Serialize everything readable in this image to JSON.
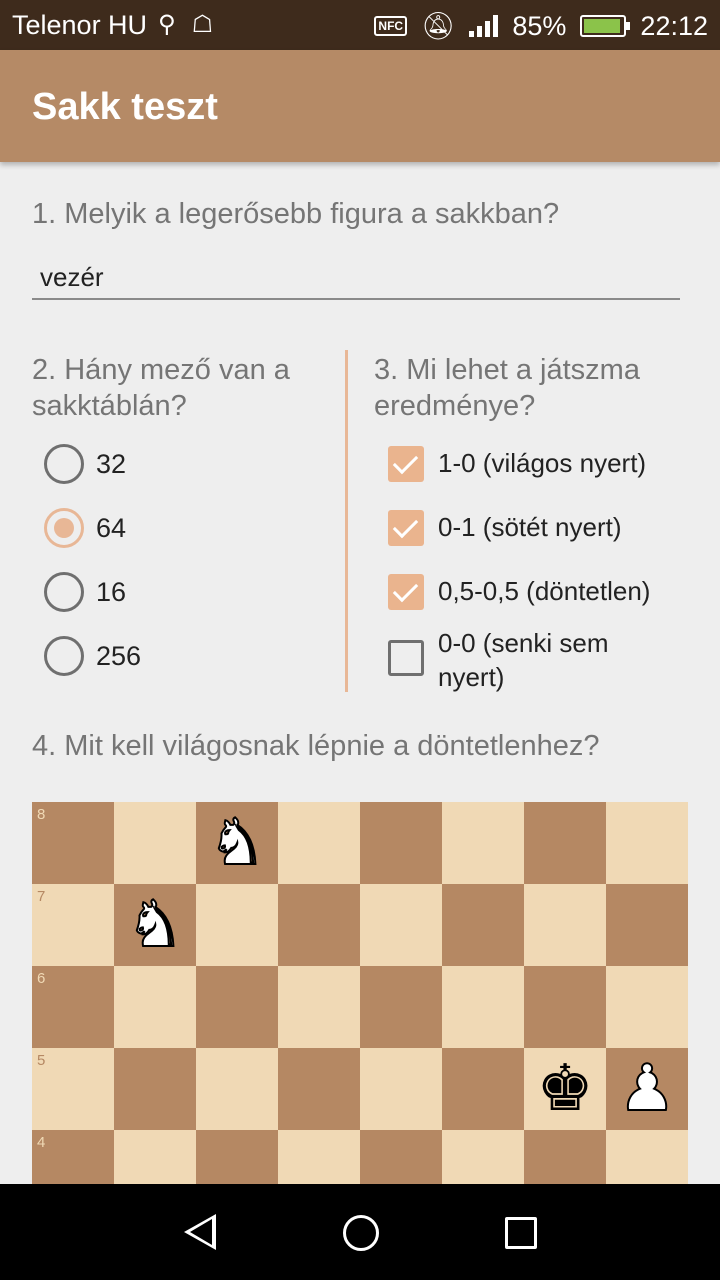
{
  "status": {
    "carrier": "Telenor HU",
    "usb_icon": "usb-icon",
    "android_icon": "android-debug-icon",
    "nfc": "NFC",
    "battery_percent": "85%",
    "battery_level": 0.85,
    "time": "22:12"
  },
  "appbar": {
    "title": "Sakk teszt"
  },
  "q1": {
    "question": "1. Melyik a legerősebb figura a sakkban?",
    "answer": "vezér"
  },
  "q2": {
    "question": "2. Hány mező van a sakktáblán?",
    "options": [
      {
        "label": "32",
        "checked": false
      },
      {
        "label": "64",
        "checked": true
      },
      {
        "label": "16",
        "checked": false
      },
      {
        "label": "256",
        "checked": false
      }
    ]
  },
  "q3": {
    "question": "3. Mi lehet a játszma eredménye?",
    "options": [
      {
        "label": "1-0 (világos nyert)",
        "checked": true
      },
      {
        "label": "0-1 (sötét nyert)",
        "checked": true
      },
      {
        "label": "0,5-0,5 (döntetlen)",
        "checked": true
      },
      {
        "label": "0-0 (senki sem nyert)",
        "checked": false
      }
    ]
  },
  "q4": {
    "question": "4. Mit kell világosnak lépnie a döntetlenhez?"
  },
  "board": {
    "ranks": [
      "8",
      "7",
      "6",
      "5",
      "4"
    ],
    "pieces": [
      {
        "square": "c8",
        "piece": "white-knight",
        "glyph": "♞"
      },
      {
        "square": "b7",
        "piece": "white-knight",
        "glyph": "♞"
      },
      {
        "square": "g5",
        "piece": "black-king",
        "glyph": "♚"
      },
      {
        "square": "h5",
        "piece": "white-pawn",
        "glyph": "♟"
      }
    ],
    "light_color": "#f0d9b5",
    "dark_color": "#b58863"
  },
  "colors": {
    "accent": "#e8b796",
    "appbar": "#b58a66"
  }
}
